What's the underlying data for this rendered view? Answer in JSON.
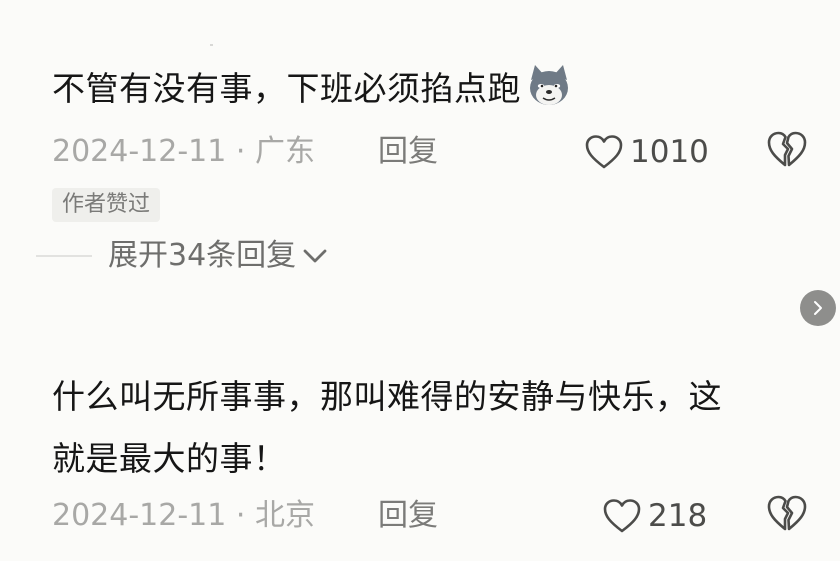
{
  "comments": [
    {
      "text": "不管有没有事，下班必须掐点跑",
      "emoji_icon": "doge-emoji-icon",
      "date": "2024-12-11",
      "location": "广东",
      "reply_label": "回复",
      "like_count": "1010",
      "badge": "作者赞过",
      "expand_label": "展开34条回复"
    },
    {
      "text_line1": "什么叫无所事事，那叫难得的安静与快乐，这",
      "text_line2": "就是最大的事！",
      "date": "2024-12-11",
      "location": "北京",
      "reply_label": "回复",
      "like_count": "218"
    }
  ],
  "meta_separator": " · ",
  "icons": {
    "like": "heart-outline-icon",
    "dislike": "broken-heart-icon",
    "expand": "chevron-down-icon",
    "next": "chevron-right-icon"
  },
  "colors": {
    "background": "#fbfbf9",
    "text": "#161616",
    "meta": "#a8a8a6",
    "badge_bg": "#efefec"
  }
}
